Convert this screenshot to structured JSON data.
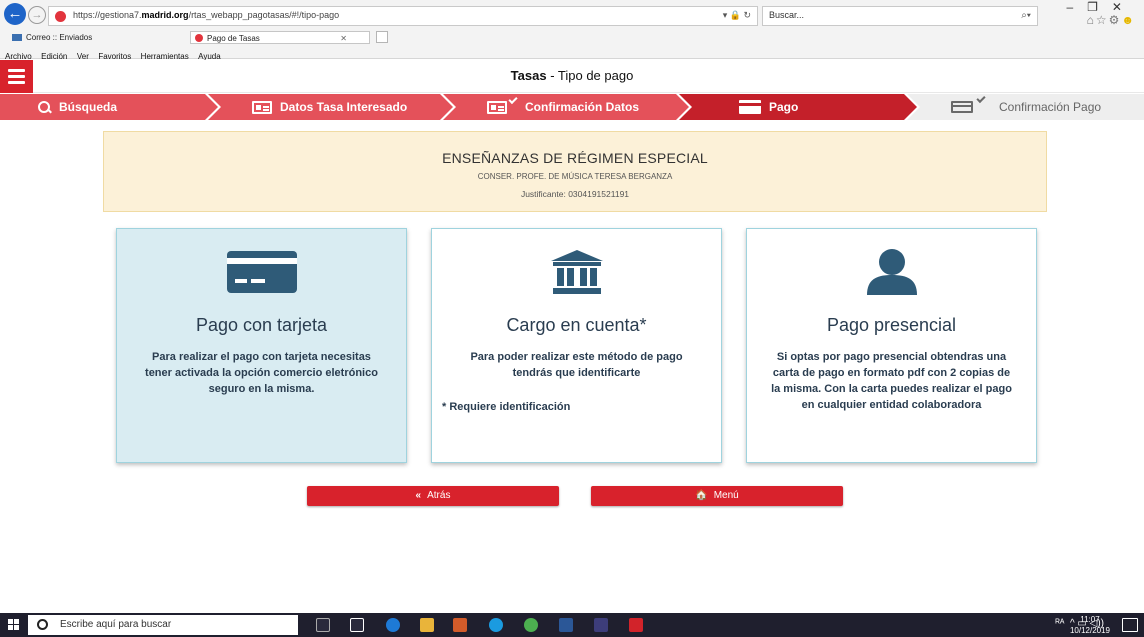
{
  "browser": {
    "url_prefix": "https://gestiona7.",
    "url_domain": "madrid.org",
    "url_path": "/rtas_webapp_pagotasas/#!/tipo-pago",
    "url_actions": "▾ 🔒 ↻",
    "search_placeholder": "Buscar...",
    "tabs": [
      {
        "label": "Correo :: Enviados"
      },
      {
        "label": "Pago de Tasas",
        "close": "✕"
      }
    ],
    "menu": [
      "Archivo",
      "Edición",
      "Ver",
      "Favoritos",
      "Herramientas",
      "Ayuda"
    ]
  },
  "header": {
    "title_bold": "Tasas",
    "title_rest": " - Tipo de pago"
  },
  "stepper": {
    "steps": [
      {
        "label": "Búsqueda",
        "state": "done"
      },
      {
        "label": "Datos Tasa Interesado",
        "state": "done"
      },
      {
        "label": "Confirmación Datos",
        "state": "done"
      },
      {
        "label": "Pago",
        "state": "active"
      },
      {
        "label": "Confirmación Pago",
        "state": "pending"
      }
    ]
  },
  "info": {
    "title": "ENSEÑANZAS DE RÉGIMEN ESPECIAL",
    "subtitle": "CONSER. PROFE. DE MÚSICA TERESA BERGANZA",
    "justificante": "Justificante: 0304191521191"
  },
  "options": [
    {
      "icon": "credit-card-icon",
      "title": "Pago con tarjeta",
      "text": "Para realizar el pago con tarjeta necesitas tener activada la opción comercio eletrónico seguro en la misma.",
      "note": ""
    },
    {
      "icon": "bank-icon",
      "title": "Cargo en cuenta*",
      "text": "Para poder realizar este método de pago tendrás que identificarte",
      "note": "* Requiere identificación"
    },
    {
      "icon": "user-icon",
      "title": "Pago presencial",
      "text": "Si optas por pago presencial obtendras una carta de pago en formato pdf con 2 copias de la misma. Con la carta puedes realizar el pago en cualquier entidad colaboradora",
      "note": ""
    }
  ],
  "buttons": {
    "back_icon": "«",
    "back_label": "Atrás",
    "menu_icon": "🏠",
    "menu_label": "Menú"
  },
  "taskbar": {
    "search_placeholder": "Escribe aquí para buscar",
    "time": "11:07",
    "date": "10/12/2019"
  },
  "colors": {
    "primary_red": "#d8222c",
    "active_step": "#c4202a",
    "pending_step": "#eeeeee",
    "card_icon": "#2f5b78",
    "info_bg": "#fcf1d8"
  }
}
